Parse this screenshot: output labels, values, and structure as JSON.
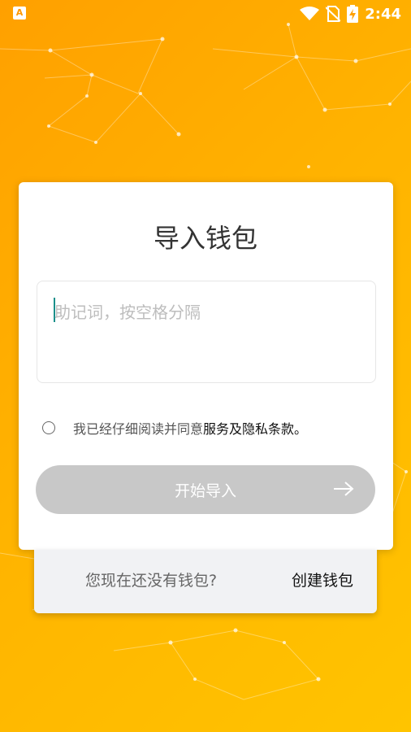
{
  "status_bar": {
    "app_badge": "A",
    "time": "2:44",
    "icons": [
      "wifi-icon",
      "no-sim-icon",
      "battery-charging-icon"
    ]
  },
  "card": {
    "title": "导入钱包",
    "mnemonic": {
      "placeholder": "助记词，按空格分隔",
      "value": ""
    },
    "agreement": {
      "text": "我已经仔细阅读并同意",
      "link": "服务及隐私条款。",
      "checked": false
    },
    "start_button": {
      "label": "开始导入",
      "icon": "arrow-right-icon"
    }
  },
  "footer": {
    "prompt": "您现在还没有钱包?",
    "create_link": "创建钱包"
  },
  "colors": {
    "background_start": "#ffa000",
    "background_end": "#ffc400",
    "button_disabled": "#c8c8c8",
    "cursor": "#1a8f8a"
  }
}
